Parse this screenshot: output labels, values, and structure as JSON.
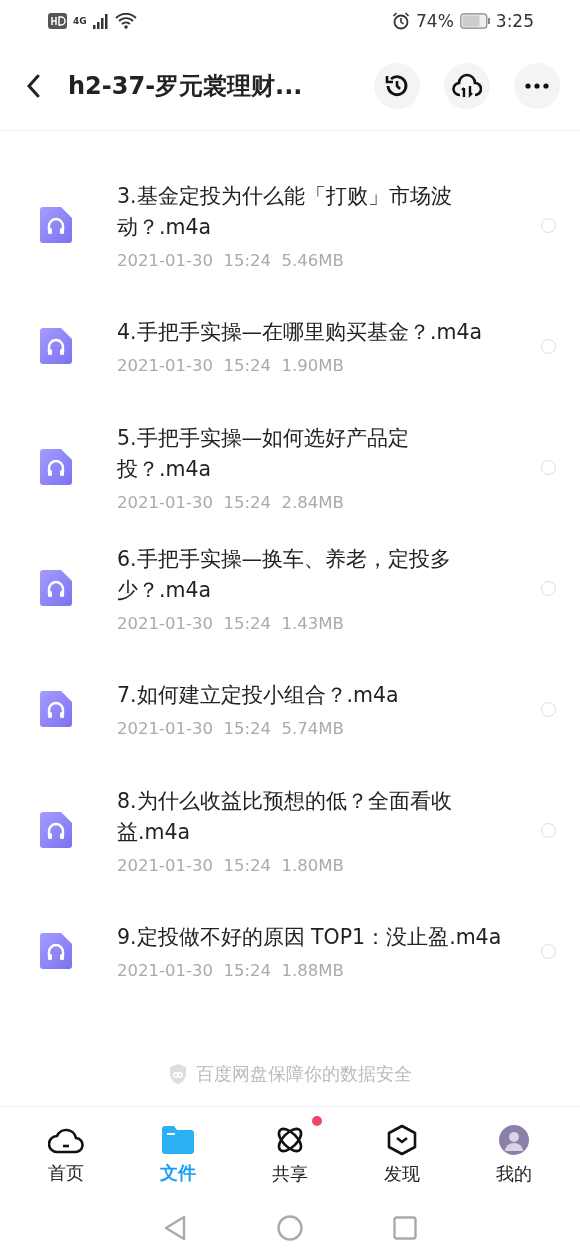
{
  "status_bar": {
    "network": "4G",
    "battery_text": "74%",
    "time": "3:25"
  },
  "header": {
    "title": "h2-37-罗元裳理财..."
  },
  "files": [
    {
      "name": "3.基金定投为什么能「打败」市场波动？.m4a",
      "date": "2021-01-30",
      "time": "15:24",
      "size": "5.46MB",
      "selected": false
    },
    {
      "name": "4.手把手实操—在哪里购买基金？.m4a",
      "date": "2021-01-30",
      "time": "15:24",
      "size": "1.90MB",
      "selected": false
    },
    {
      "name": "5.手把手实操—如何选好产品定投？.m4a",
      "date": "2021-01-30",
      "time": "15:24",
      "size": "2.84MB",
      "selected": false
    },
    {
      "name": "6.手把手实操—换车、养老，定投多少？.m4a",
      "date": "2021-01-30",
      "time": "15:24",
      "size": "1.43MB",
      "selected": false
    },
    {
      "name": "7.如何建立定投小组合？.m4a",
      "date": "2021-01-30",
      "time": "15:24",
      "size": "5.74MB",
      "selected": false
    },
    {
      "name": "8.为什么收益比预想的低？全面看收益.m4a",
      "date": "2021-01-30",
      "time": "15:24",
      "size": "1.80MB",
      "selected": false
    },
    {
      "name": "9.定投做不好的原因 TOP1：没止盈.m4a",
      "date": "2021-01-30",
      "time": "15:24",
      "size": "1.88MB",
      "selected": false
    }
  ],
  "footer_note": "百度网盘保障你的数据安全",
  "tabs": [
    {
      "kind": "home",
      "label": "首页",
      "selected": false,
      "badge": false
    },
    {
      "kind": "files",
      "label": "文件",
      "selected": true,
      "badge": false
    },
    {
      "kind": "share",
      "label": "共享",
      "selected": false,
      "badge": true
    },
    {
      "kind": "discover",
      "label": "发现",
      "selected": false,
      "badge": false
    },
    {
      "kind": "me",
      "label": "我的",
      "selected": false,
      "badge": false
    }
  ]
}
